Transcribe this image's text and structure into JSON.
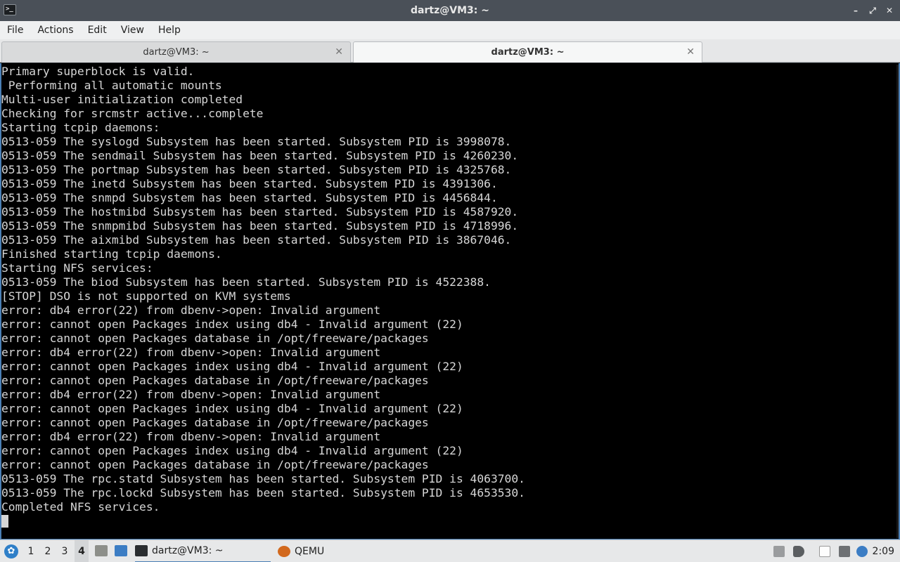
{
  "window": {
    "title": "dartz@VM3: ~",
    "app_icon": "terminal-icon",
    "controls": [
      "minimize-icon",
      "maximize-icon",
      "close-icon"
    ]
  },
  "menubar": {
    "items": [
      "File",
      "Actions",
      "Edit",
      "View",
      "Help"
    ]
  },
  "tabs": [
    {
      "label": "dartz@VM3: ~",
      "active": false
    },
    {
      "label": "dartz@VM3: ~",
      "active": true
    }
  ],
  "terminal": {
    "lines": [
      "Primary superblock is valid.",
      " Performing all automatic mounts",
      "Multi-user initialization completed",
      "Checking for srcmstr active...complete",
      "Starting tcpip daemons:",
      "0513-059 The syslogd Subsystem has been started. Subsystem PID is 3998078.",
      "0513-059 The sendmail Subsystem has been started. Subsystem PID is 4260230.",
      "0513-059 The portmap Subsystem has been started. Subsystem PID is 4325768.",
      "0513-059 The inetd Subsystem has been started. Subsystem PID is 4391306.",
      "0513-059 The snmpd Subsystem has been started. Subsystem PID is 4456844.",
      "0513-059 The hostmibd Subsystem has been started. Subsystem PID is 4587920.",
      "0513-059 The snmpmibd Subsystem has been started. Subsystem PID is 4718996.",
      "0513-059 The aixmibd Subsystem has been started. Subsystem PID is 3867046.",
      "Finished starting tcpip daemons.",
      "Starting NFS services:",
      "0513-059 The biod Subsystem has been started. Subsystem PID is 4522388.",
      "[STOP] DSO is not supported on KVM systems",
      "error: db4 error(22) from dbenv->open: Invalid argument",
      "error: cannot open Packages index using db4 - Invalid argument (22)",
      "error: cannot open Packages database in /opt/freeware/packages",
      "error: db4 error(22) from dbenv->open: Invalid argument",
      "error: cannot open Packages index using db4 - Invalid argument (22)",
      "error: cannot open Packages database in /opt/freeware/packages",
      "error: db4 error(22) from dbenv->open: Invalid argument",
      "error: cannot open Packages index using db4 - Invalid argument (22)",
      "error: cannot open Packages database in /opt/freeware/packages",
      "error: db4 error(22) from dbenv->open: Invalid argument",
      "error: cannot open Packages index using db4 - Invalid argument (22)",
      "error: cannot open Packages database in /opt/freeware/packages",
      "0513-059 The rpc.statd Subsystem has been started. Subsystem PID is 4063700.",
      "0513-059 The rpc.lockd Subsystem has been started. Subsystem PID is 4653530.",
      "Completed NFS services."
    ]
  },
  "taskbar": {
    "start_icon": "lubuntu-start-icon",
    "workspaces": [
      "1",
      "2",
      "3",
      "4"
    ],
    "current_workspace": "4",
    "quicklaunch": [
      "file-manager-icon",
      "desktop-icon"
    ],
    "tasks": [
      {
        "label": "dartz@VM3: ~",
        "icon": "terminal-icon",
        "active": true
      },
      {
        "label": "QEMU",
        "icon": "qemu-icon",
        "active": false
      }
    ],
    "tray": [
      "eject-icon",
      "volume-icon",
      "clipboard-icon",
      "network-icon",
      "update-notifier-icon"
    ],
    "clock": "2:09",
    "colors": {
      "accent": "#4a7fb5",
      "terminal_bg": "#000000",
      "terminal_fg": "#d6d6d6"
    }
  }
}
